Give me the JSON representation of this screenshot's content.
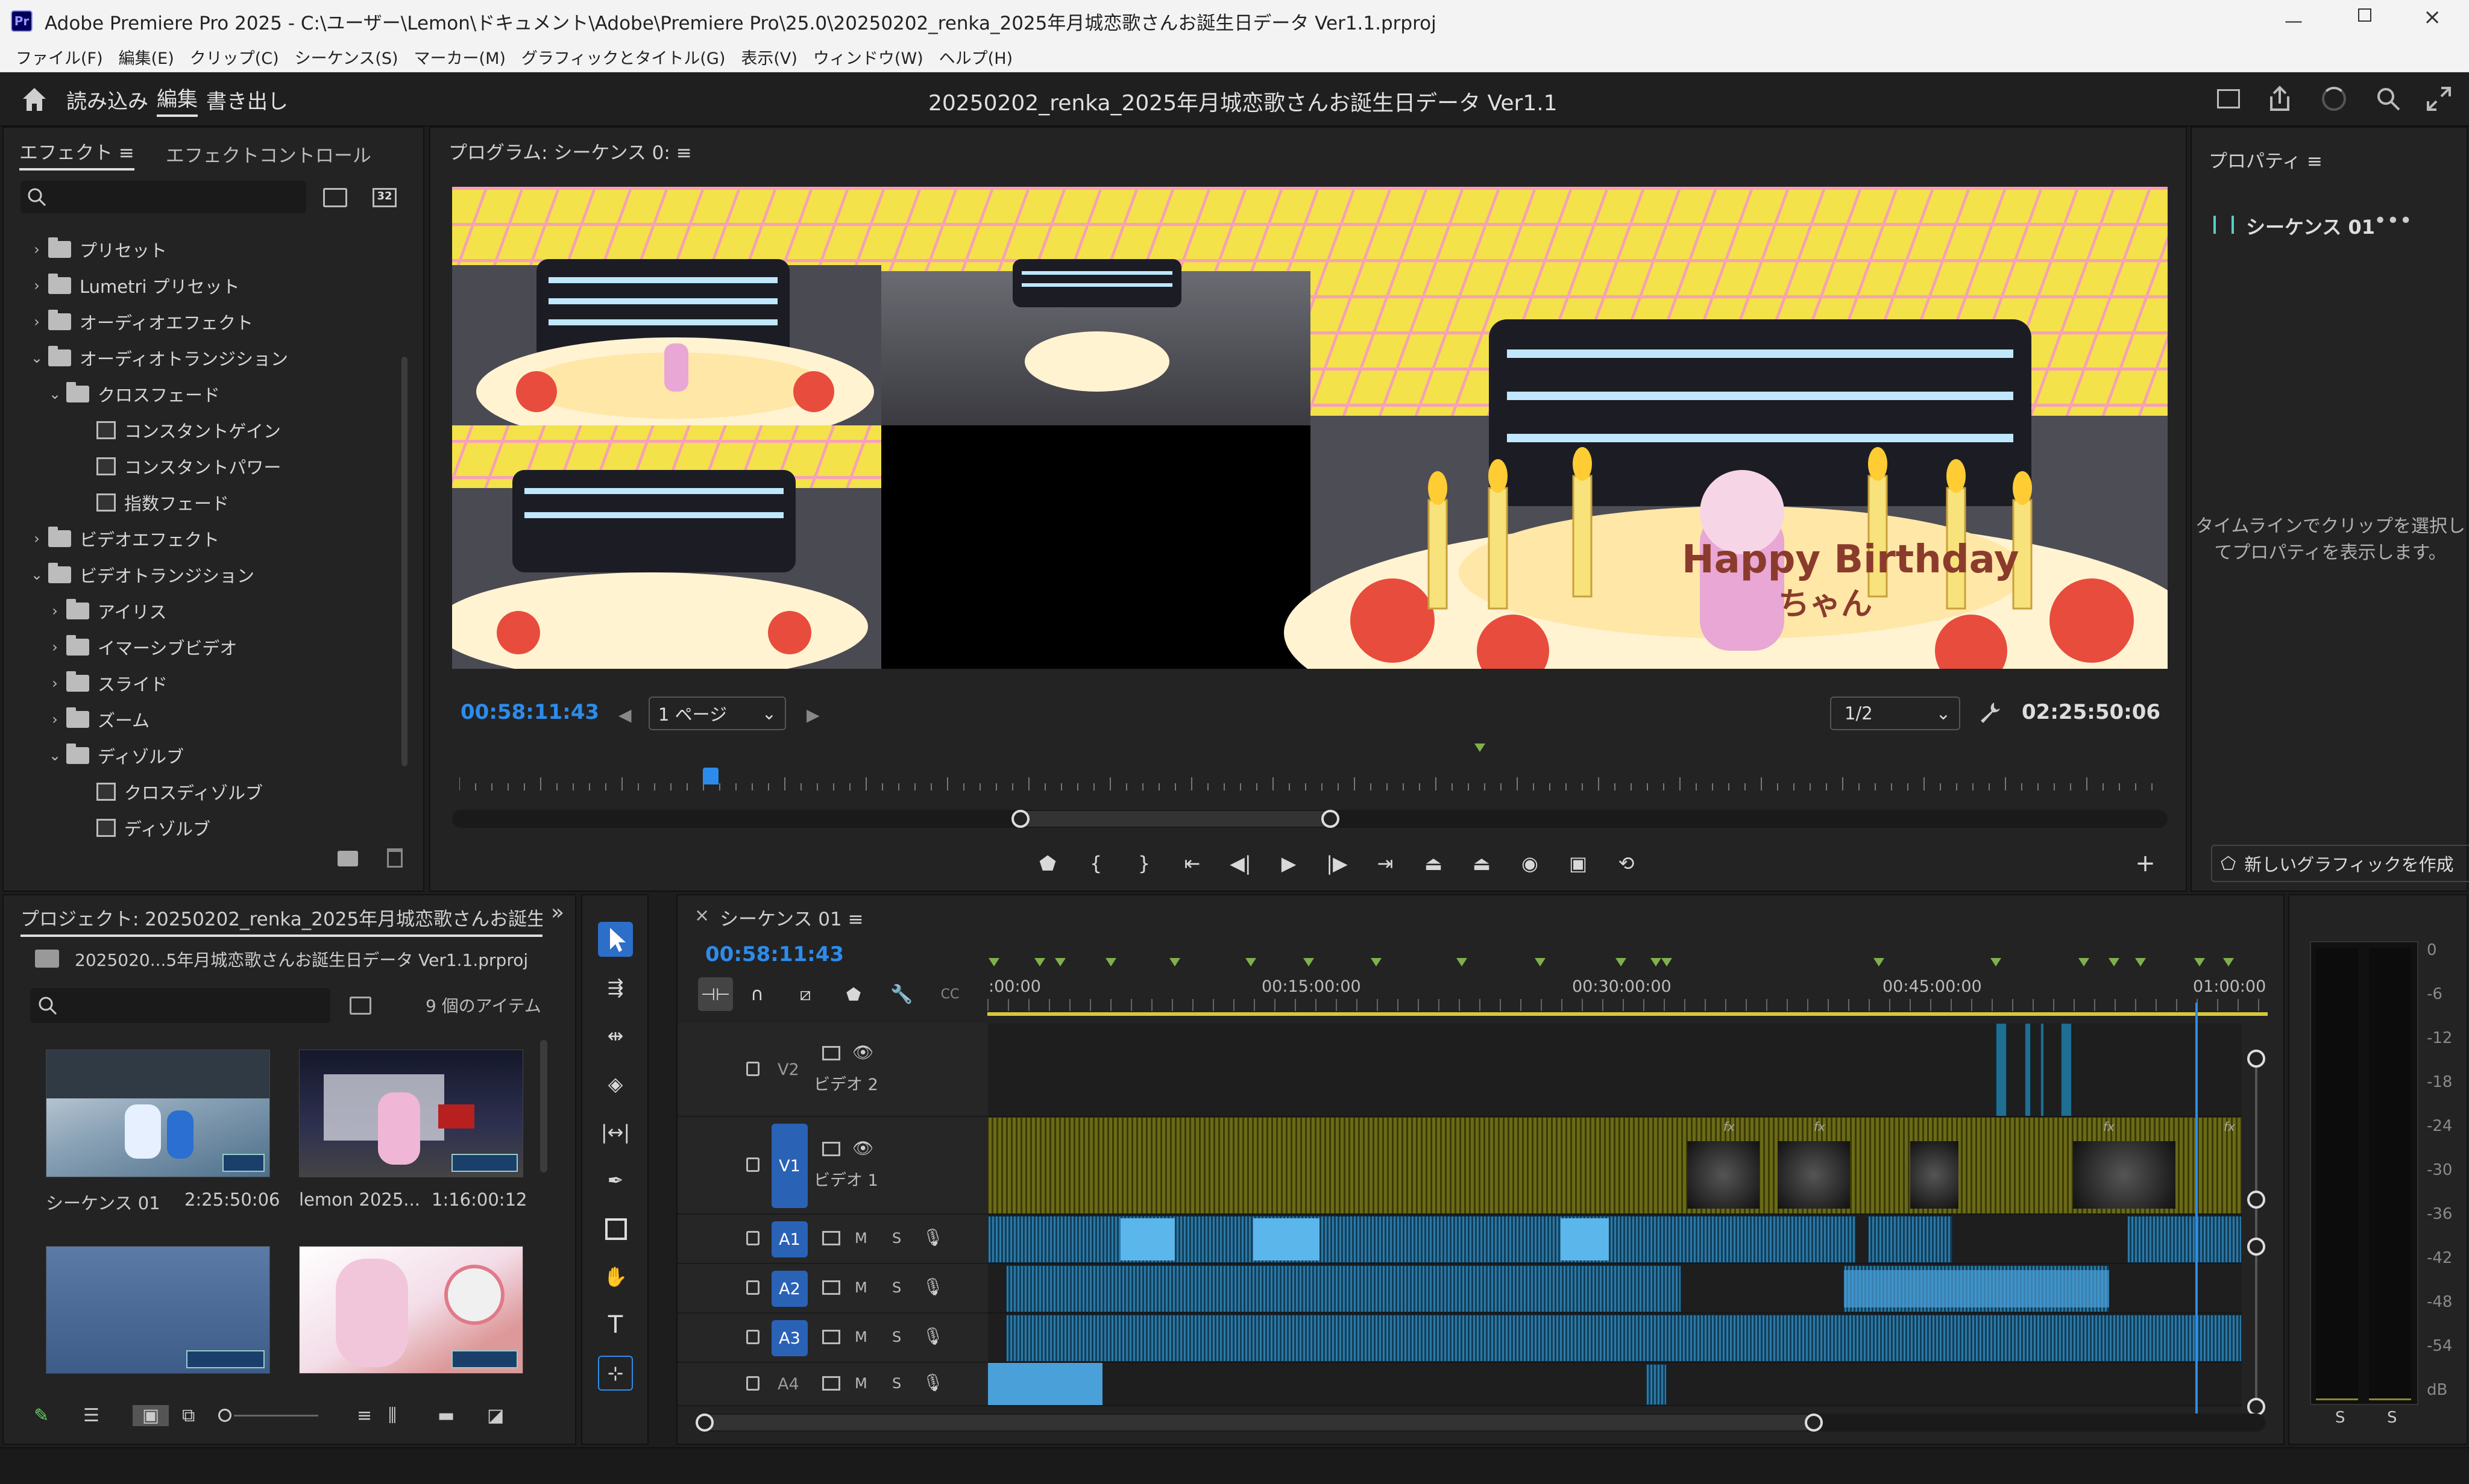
{
  "window": {
    "title": "Adobe Premiere Pro 2025 - C:\\ユーザー\\Lemon\\ドキュメント\\Adobe\\Premiere Pro\\25.0\\20250202_renka_2025年月城恋歌さんお誕生日データ Ver1.1.prproj",
    "app_badge": "Pr"
  },
  "menu": [
    "ファイル(F)",
    "編集(E)",
    "クリップ(C)",
    "シーケンス(S)",
    "マーカー(M)",
    "グラフィックとタイトル(G)",
    "表示(V)",
    "ウィンドウ(W)",
    "ヘルプ(H)"
  ],
  "workspace": {
    "tabs": [
      "読み込み",
      "編集",
      "書き出し"
    ],
    "active_tab": "編集",
    "project_title": "20250202_renka_2025年月城恋歌さんお誕生日データ Ver1.1"
  },
  "effects_panel": {
    "tabs": [
      "エフェクト ≡",
      "エフェクトコントロール"
    ],
    "badge_32": "32",
    "tree": [
      {
        "label": "プリセット",
        "depth": 0,
        "expanded": false,
        "kind": "folder-star"
      },
      {
        "label": "Lumetri プリセット",
        "depth": 0,
        "expanded": false,
        "kind": "folder-star"
      },
      {
        "label": "オーディオエフェクト",
        "depth": 0,
        "expanded": false,
        "kind": "folder"
      },
      {
        "label": "オーディオトランジション",
        "depth": 0,
        "expanded": true,
        "kind": "folder"
      },
      {
        "label": "クロスフェード",
        "depth": 1,
        "expanded": true,
        "kind": "folder"
      },
      {
        "label": "コンスタントゲイン",
        "depth": 2,
        "kind": "fx"
      },
      {
        "label": "コンスタントパワー",
        "depth": 2,
        "kind": "fx"
      },
      {
        "label": "指数フェード",
        "depth": 2,
        "kind": "fx"
      },
      {
        "label": "ビデオエフェクト",
        "depth": 0,
        "expanded": false,
        "kind": "folder"
      },
      {
        "label": "ビデオトランジション",
        "depth": 0,
        "expanded": true,
        "kind": "folder"
      },
      {
        "label": "アイリス",
        "depth": 1,
        "expanded": false,
        "kind": "folder"
      },
      {
        "label": "イマーシブビデオ",
        "depth": 1,
        "expanded": false,
        "kind": "folder"
      },
      {
        "label": "スライド",
        "depth": 1,
        "expanded": false,
        "kind": "folder"
      },
      {
        "label": "ズーム",
        "depth": 1,
        "expanded": false,
        "kind": "folder"
      },
      {
        "label": "ディゾルブ",
        "depth": 1,
        "expanded": true,
        "kind": "folder"
      },
      {
        "label": "クロスディゾルブ",
        "depth": 2,
        "kind": "fx"
      },
      {
        "label": "ディゾルブ",
        "depth": 2,
        "kind": "fx"
      }
    ]
  },
  "program_monitor": {
    "title": "プログラム: シーケンス 0: ≡",
    "timecode": "00:58:11:43",
    "page_select": "1 ページ",
    "zoom_select": "1/2",
    "duration": "02:25:50:06",
    "playhead_fraction": 0.142,
    "cake_text": "Happy Birthday",
    "cake_subtext": "ちゃん"
  },
  "properties_panel": {
    "title": "プロパティ ≡",
    "sequence_name": "シーケンス 01",
    "hint": "タイムラインでクリップを選択してプロパティを表示します。",
    "new_graphic": "新しいグラフィックを作成"
  },
  "project_panel": {
    "title": "プロジェクト: 20250202_renka_2025年月城恋歌さんお誕生E",
    "file": "2025020...5年月城恋歌さんお誕生日データ Ver1.1.prproj",
    "item_count": "9 個のアイテム",
    "items": [
      {
        "name": "シーケンス 01",
        "duration": "2:25:50:06"
      },
      {
        "name": "lemon 2025...",
        "duration": "1:16:00:12"
      },
      {
        "name": "",
        "duration": ""
      },
      {
        "name": "",
        "duration": ""
      }
    ]
  },
  "timeline": {
    "tab": "シーケンス 01 ≡",
    "close": "×",
    "timecode": "00:58:11:43",
    "ruler": [
      ":00:00",
      "00:15:00:00",
      "00:30:00:00",
      "00:45:00:00",
      "01:00:00"
    ],
    "playhead_fraction": 0.963,
    "tracks": [
      {
        "id": "V2",
        "label": "ビデオ 2",
        "type": "video"
      },
      {
        "id": "V1",
        "label": "ビデオ 1",
        "type": "video"
      },
      {
        "id": "A1",
        "label": "",
        "type": "audio"
      },
      {
        "id": "A2",
        "label": "",
        "type": "audio"
      },
      {
        "id": "A3",
        "label": "",
        "type": "audio"
      },
      {
        "id": "A4",
        "label": "",
        "type": "audio"
      }
    ],
    "track_buttons": {
      "mute": "M",
      "solo": "S"
    },
    "fx_label": "fx"
  },
  "audio_meter": {
    "scale": [
      "0",
      "-6",
      "-12",
      "-18",
      "-24",
      "-30",
      "-36",
      "-42",
      "-48",
      "-54",
      "dB"
    ],
    "channels": [
      "S",
      "S"
    ]
  },
  "colors": {
    "accent": "#2d8ceb",
    "clip_video": "#5a5a14",
    "clip_audio": "#1b4e6c",
    "track_active": "#2a62b6",
    "marker": "#7fb04c"
  }
}
